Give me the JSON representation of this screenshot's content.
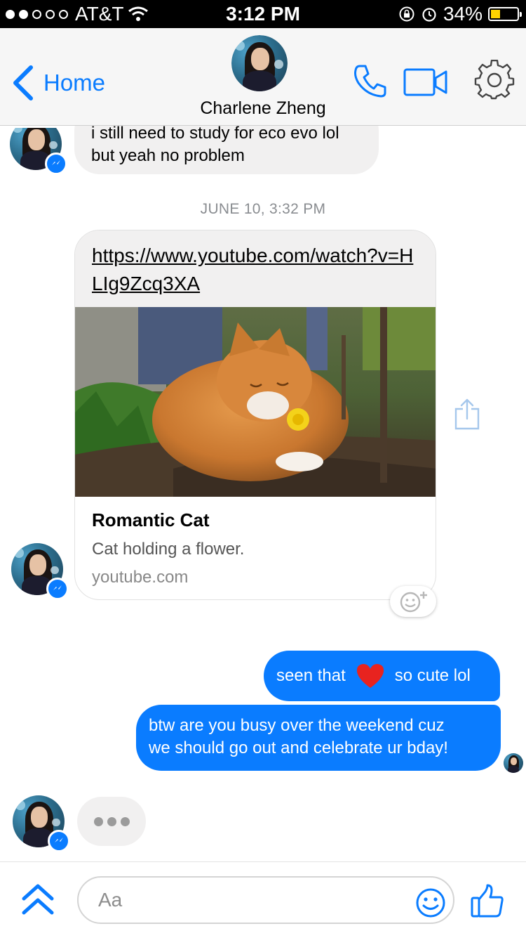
{
  "status_bar": {
    "carrier": "AT&T",
    "time": "3:12 PM",
    "battery": "34%",
    "battery_level": 0.34,
    "signal_bars": 2
  },
  "nav": {
    "back_label": "Home",
    "contact_name": "Charlene Zheng",
    "icons": [
      "chevron-left-icon",
      "phone-icon",
      "video-icon",
      "gear-icon"
    ]
  },
  "conversation": {
    "prev_message": {
      "line1": "i still need to study for eco evo lol",
      "line2": "but yeah no problem"
    },
    "timestamp": "JUNE 10, 3:32 PM",
    "link_message": {
      "url": "https://www.youtube.com/watch?v=HLIg9Zcq3XA",
      "title": "Romantic Cat",
      "description": "Cat holding a flower.",
      "domain": "youtube.com"
    },
    "outgoing": [
      {
        "before": "seen that",
        "emoji": "heart",
        "after": "so cute lol"
      },
      {
        "line1": "btw are you busy over the weekend cuz",
        "line2": "we should go out and celebrate ur bday!"
      }
    ]
  },
  "composer": {
    "placeholder": "Aa"
  },
  "colors": {
    "accent": "#0a7cff",
    "incoming_bubble": "#f1f0f0",
    "status_bar": "#000000",
    "battery_fill": "#ffd400"
  }
}
